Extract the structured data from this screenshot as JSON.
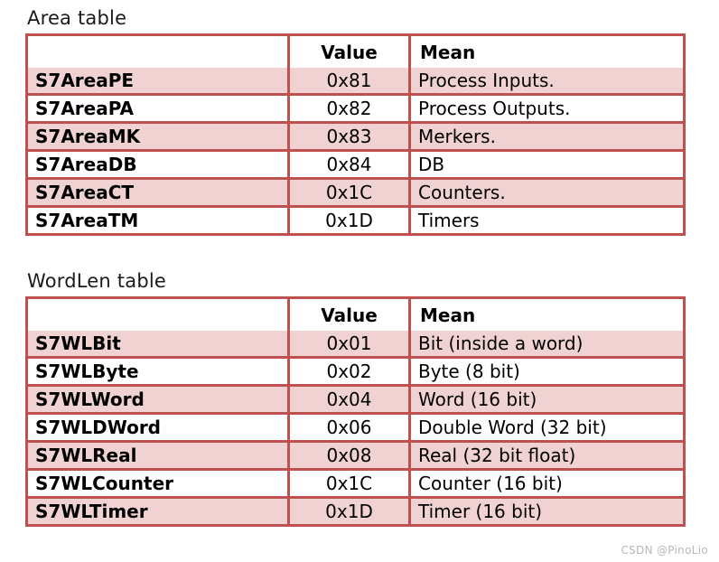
{
  "tables": [
    {
      "title": "Area table",
      "columns": [
        "",
        "Value",
        "Mean"
      ],
      "rows": [
        {
          "name": "S7AreaPE",
          "value": "0x81",
          "mean": "Process Inputs."
        },
        {
          "name": "S7AreaPA",
          "value": "0x82",
          "mean": "Process Outputs."
        },
        {
          "name": "S7AreaMK",
          "value": "0x83",
          "mean": "Merkers."
        },
        {
          "name": "S7AreaDB",
          "value": "0x84",
          "mean": "DB"
        },
        {
          "name": "S7AreaCT",
          "value": "0x1C",
          "mean": "Counters."
        },
        {
          "name": "S7AreaTM",
          "value": "0x1D",
          "mean": "Timers"
        }
      ]
    },
    {
      "title": "WordLen table",
      "columns": [
        "",
        "Value",
        "Mean"
      ],
      "rows": [
        {
          "name": "S7WLBit",
          "value": "0x01",
          "mean": "Bit (inside a word)"
        },
        {
          "name": "S7WLByte",
          "value": "0x02",
          "mean": "Byte (8 bit)"
        },
        {
          "name": "S7WLWord",
          "value": "0x04",
          "mean": "Word (16 bit)"
        },
        {
          "name": "S7WLDWord",
          "value": "0x06",
          "mean": "Double Word (32 bit)"
        },
        {
          "name": "S7WLReal",
          "value": "0x08",
          "mean": "Real (32 bit float)"
        },
        {
          "name": "S7WLCounter",
          "value": "0x1C",
          "mean": "Counter (16 bit)"
        },
        {
          "name": "S7WLTimer",
          "value": "0x1D",
          "mean": "Timer (16 bit)"
        }
      ]
    }
  ],
  "watermark": "CSDN @PinoLio",
  "colors": {
    "border": "#bf5050",
    "stripe": "#f0d2d2",
    "plain": "#ffffff",
    "text": "#000000",
    "watermark_text": "#b9b9b9"
  }
}
